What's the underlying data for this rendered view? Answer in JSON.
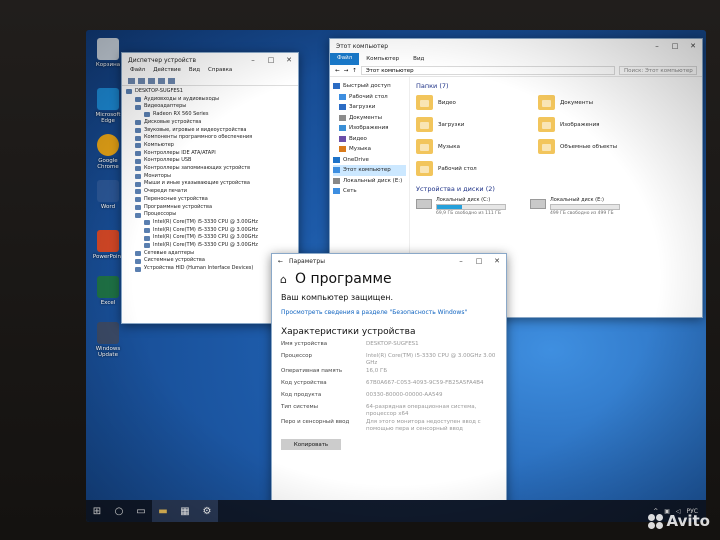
{
  "desktop_icons": [
    {
      "label": "Корзина",
      "icon": "recycle-bin-icon"
    },
    {
      "label": "Microsoft Edge",
      "icon": "edge-icon"
    },
    {
      "label": "Google Chrome",
      "icon": "chrome-icon"
    },
    {
      "label": "Word",
      "icon": "word-icon"
    },
    {
      "label": "PowerPoint",
      "icon": "powerpoint-icon"
    },
    {
      "label": "Excel",
      "icon": "excel-icon"
    },
    {
      "label": "Windows Update",
      "icon": "setup-icon"
    }
  ],
  "device_manager": {
    "title": "Диспетчер устройств",
    "menu": [
      "Файл",
      "Действие",
      "Вид",
      "Справка"
    ],
    "tree": [
      "DESKTOP-SUGFES1",
      "Аудиовходы и аудиовыходы",
      "Видеоадаптеры",
      "Radeon RX 560 Series",
      "Дисковые устройства",
      "Звуковые, игровые и видеоустройства",
      "Компоненты программного обеспечения",
      "Компьютер",
      "Контроллеры IDE ATA/ATAPI",
      "Контроллеры USB",
      "Контроллеры запоминающих устройств",
      "Мониторы",
      "Мыши и иные указывающие устройства",
      "Очереди печати",
      "Переносные устройства",
      "Программные устройства",
      "Процессоры",
      "Intel(R) Core(TM) i5-3330 CPU @ 3.00GHz",
      "Intel(R) Core(TM) i5-3330 CPU @ 3.00GHz",
      "Intel(R) Core(TM) i5-3330 CPU @ 3.00GHz",
      "Intel(R) Core(TM) i5-3330 CPU @ 3.00GHz",
      "Сетевые адаптеры",
      "Системные устройства",
      "Устройства HID (Human Interface Devices)"
    ]
  },
  "explorer": {
    "title": "Этот компьютер",
    "ribbon": [
      "Файл",
      "Компьютер",
      "Вид"
    ],
    "address": "Этот компьютер",
    "search_placeholder": "Поиск: Этот компьютер",
    "nav": [
      {
        "label": "Быстрый доступ",
        "color": "#2b6cc4"
      },
      {
        "label": "Рабочий стол",
        "color": "#3d8ee0"
      },
      {
        "label": "Загрузки",
        "color": "#2b6cc4"
      },
      {
        "label": "Документы",
        "color": "#8c8c8c"
      },
      {
        "label": "Изображения",
        "color": "#3a8fd6"
      },
      {
        "label": "Видео",
        "color": "#6b4ea8"
      },
      {
        "label": "Музыка",
        "color": "#d97a1a"
      },
      {
        "label": "OneDrive",
        "color": "#1e73c9"
      },
      {
        "label": "Этот компьютер",
        "color": "#3d8ee0"
      },
      {
        "label": "Локальный диск (E:)",
        "color": "#888888"
      },
      {
        "label": "Сеть",
        "color": "#3d8ee0"
      }
    ],
    "folders_header": "Папки (7)",
    "folders": [
      "Видео",
      "Документы",
      "Загрузки",
      "Изображения",
      "Музыка",
      "Объемные объекты",
      "Рабочий стол"
    ],
    "drives_header": "Устройства и диски (2)",
    "drives": [
      {
        "name": "Локальный диск (C:)",
        "free": "69,9 ГБ свободно из 111 ГБ",
        "used_fraction": 0.37
      },
      {
        "name": "Локальный диск (E:)",
        "free": "499 ГБ свободно из 499 ГБ",
        "used_fraction": 0.0
      }
    ]
  },
  "settings": {
    "window_title": "Параметры",
    "page_title": "О программе",
    "protected": "Ваш компьютер защищен.",
    "link": "Просмотреть сведения в разделе \"Безопасность Windows\"",
    "section": "Характеристики устройства",
    "specs": [
      {
        "k": "Имя устройства",
        "v": "DESKTOP-SUGFES1"
      },
      {
        "k": "Процессор",
        "v": "Intel(R) Core(TM) i5-3330 CPU @ 3.00GHz 3.00 GHz"
      },
      {
        "k": "Оперативная память",
        "v": "16,0 ГБ"
      },
      {
        "k": "Код устройства",
        "v": "67B0A667-C053-4093-9C59-FB25A5FA4B4"
      },
      {
        "k": "Код продукта",
        "v": "00330-80000-00000-AA549"
      },
      {
        "k": "Тип системы",
        "v": "64-разрядная операционная система, процессор x64"
      },
      {
        "k": "Перо и сенсорный ввод",
        "v": "Для этого монитора недоступен ввод с помощью пера и сенсорный ввод"
      }
    ],
    "copy_button": "Копировать"
  },
  "taskbar": {
    "tray_lang": "РУС",
    "tray_time": "",
    "tray_date": ""
  },
  "watermark": "Avito"
}
